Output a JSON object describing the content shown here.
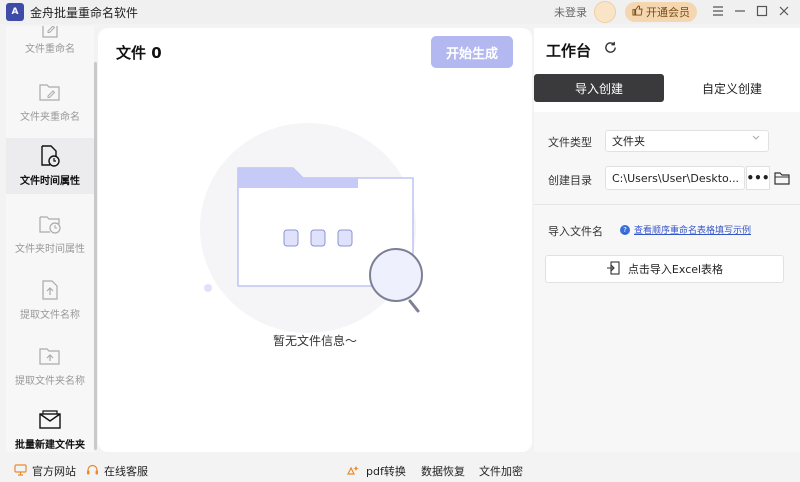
{
  "app": {
    "title": "金舟批量重命名软件",
    "logo_text": "A"
  },
  "titlebar": {
    "login_text": "未登录",
    "vip_label": "开通会员"
  },
  "sidebar": {
    "items": [
      {
        "label": "文件重命名",
        "icon": "file-edit-icon",
        "active": false
      },
      {
        "label": "文件夹重命名",
        "icon": "folder-edit-icon",
        "active": false
      },
      {
        "label": "文件时间属性",
        "icon": "file-clock-icon",
        "active": true
      },
      {
        "label": "文件夹时间属性",
        "icon": "folder-clock-icon",
        "active": false
      },
      {
        "label": "提取文件名称",
        "icon": "file-upload-icon",
        "active": false
      },
      {
        "label": "提取文件夹名称",
        "icon": "folder-upload-icon",
        "active": false
      },
      {
        "label": "批量新建文件夹",
        "icon": "folder-mail-icon",
        "active": false
      }
    ]
  },
  "main": {
    "file_count_label": "文件 0",
    "generate_button": "开始生成",
    "empty_message": "暂无文件信息～"
  },
  "workbench": {
    "title": "工作台",
    "tabs": [
      {
        "label": "导入创建",
        "active": true
      },
      {
        "label": "自定义创建",
        "active": false
      }
    ],
    "file_type_label": "文件类型",
    "file_type_value": "文件夹",
    "create_dir_label": "创建目录",
    "create_dir_value": "C:\\Users\\User\\Deskto...",
    "more_button": "•••",
    "import_name_label": "导入文件名",
    "help_link": "查看顺序重命名表格填写示例",
    "import_excel_button": "点击导入Excel表格"
  },
  "bottombar": {
    "official_site": "官方网站",
    "online_service": "在线客服",
    "pdf_convert": "pdf转换",
    "data_recovery": "数据恢复",
    "file_encrypt": "文件加密"
  },
  "colors": {
    "accent": "#b3b9f0",
    "tab_active": "#3a3a3c",
    "link": "#3556c8",
    "vip": "#f4d7b0"
  }
}
